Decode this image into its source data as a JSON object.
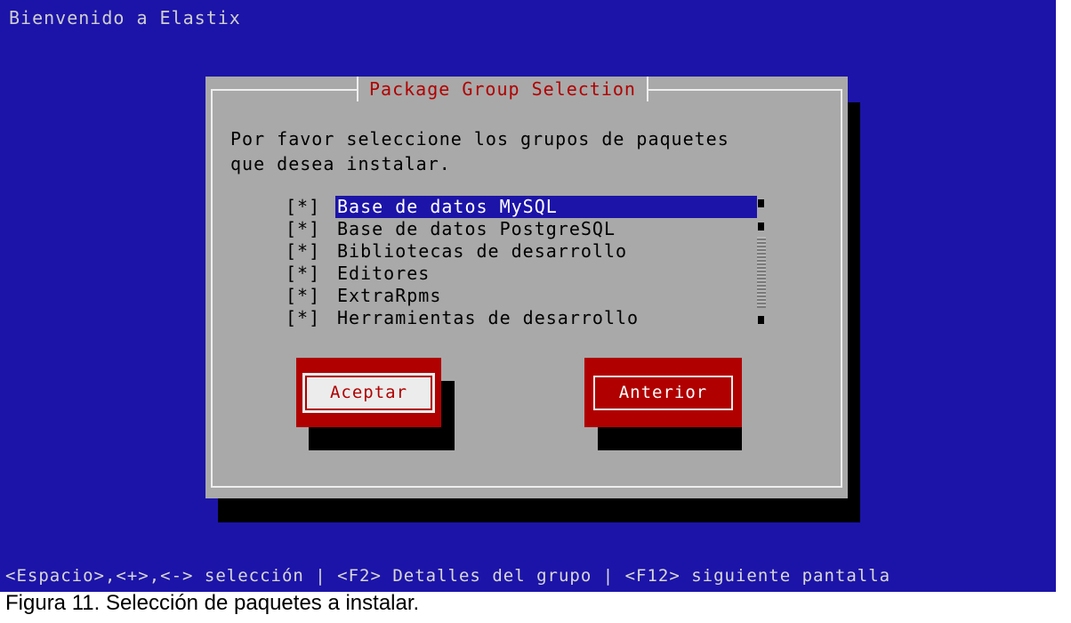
{
  "header": {
    "title": "Bienvenido a Elastix"
  },
  "dialog": {
    "title": "Package Group Selection",
    "prompt_line1": "Por favor seleccione los grupos de paquetes",
    "prompt_line2": "que desea instalar.",
    "items": [
      {
        "check": "[*]",
        "label": "Base de datos MySQL",
        "selected": true
      },
      {
        "check": "[*]",
        "label": "Base de datos PostgreSQL",
        "selected": false
      },
      {
        "check": "[*]",
        "label": "Bibliotecas de desarrollo",
        "selected": false
      },
      {
        "check": "[*]",
        "label": "Editores",
        "selected": false
      },
      {
        "check": "[*]",
        "label": "ExtraRpms",
        "selected": false
      },
      {
        "check": "[*]",
        "label": "Herramientas de desarrollo",
        "selected": false
      }
    ],
    "buttons": {
      "accept": "Aceptar",
      "back": "Anterior"
    }
  },
  "status_bar": {
    "text": "<Espacio>,<+>,<-> selección | <F2> Detalles del grupo | <F12> siguiente pantalla"
  },
  "caption": {
    "text": "Figura 11. Selección de paquetes a instalar."
  },
  "colors": {
    "background": "#1c14a8",
    "dialog": "#a9a9a9",
    "accent": "#b00000",
    "selection": "#1c14a8"
  }
}
